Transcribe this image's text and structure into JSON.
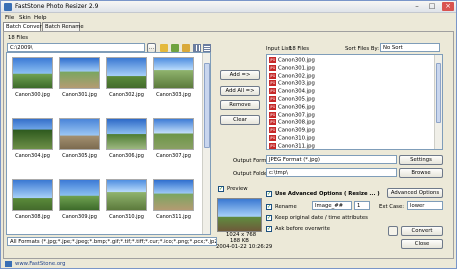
{
  "window": {
    "title": "FastStone Photo Resizer 2.9",
    "minimize_glyph": "–",
    "maximize_glyph": "□",
    "close_glyph": "×"
  },
  "menu": [
    "File",
    "Skin",
    "Help"
  ],
  "tabs": [
    "Batch Convert",
    "Batch Rename"
  ],
  "left": {
    "files_count": "18 Files",
    "folder_path": "C:\\2009\\",
    "thumbnails": [
      {
        "name": "Canon300.jpg",
        "style": "p0"
      },
      {
        "name": "Canon301.jpg",
        "style": "p1"
      },
      {
        "name": "Canon302.jpg",
        "style": "p2"
      },
      {
        "name": "Canon303.jpg",
        "style": "p3"
      },
      {
        "name": "Canon304.jpg",
        "style": "p4"
      },
      {
        "name": "Canon305.jpg",
        "style": "p5"
      },
      {
        "name": "Canon306.jpg",
        "style": "p6"
      },
      {
        "name": "Canon307.jpg",
        "style": "p7"
      },
      {
        "name": "Canon308.jpg",
        "style": "p2"
      },
      {
        "name": "Canon309.jpg",
        "style": "p0"
      },
      {
        "name": "Canon310.jpg",
        "style": "p3"
      },
      {
        "name": "Canon311.jpg",
        "style": "p1"
      }
    ],
    "format_filter": "All Formats (*.jpg;*.jpe;*.jpeg;*.bmp;*.gif;*.tif;*.tiff;*.cur;*.ico;*.png;*.pcx;*.jp2;*.j2k"
  },
  "middle": {
    "add": "Add =>",
    "add_all": "Add All =>",
    "remove": "Remove",
    "clear": "Clear"
  },
  "right": {
    "input_list_label": "Input List:",
    "input_count": "18 Files",
    "sort_label": "Sort Files By:",
    "sort_value": "No Sort",
    "input_files": [
      "Canon300.jpg",
      "Canon301.jpg",
      "Canon302.jpg",
      "Canon303.jpg",
      "Canon304.jpg",
      "Canon305.jpg",
      "Canon306.jpg",
      "Canon307.jpg",
      "Canon308.jpg",
      "Canon309.jpg",
      "Canon310.jpg",
      "Canon311.jpg"
    ],
    "output_format_label": "Output Format:",
    "output_format_value": "JPEG Format (*.jpg)",
    "settings": "Settings",
    "output_folder_label": "Output Folder:",
    "output_folder_value": "c:\\tmp\\",
    "browse": "Browse",
    "preview_label": "Preview",
    "preview_dims": "1024 x 768",
    "preview_size": "188 KB",
    "preview_date": "2004-01-22 10:26:29",
    "use_advanced": "Use Advanced Options ( Resize ... )",
    "advanced_options": "Advanced Options",
    "rename_label": "Rename",
    "rename_pattern": "Image_##",
    "rename_start": "1",
    "ext_case_label": "Ext Case:",
    "ext_case_value": "lower",
    "keep_date": "Keep original date / time attributes",
    "ask_overwrite": "Ask before overwrite",
    "convert": "Convert",
    "close": "Close"
  },
  "footer": {
    "link": "www.FastStone.org"
  },
  "colors": {
    "accent": "#3a6fb5",
    "file_icon": "#c62828",
    "check": "#1a7a1a"
  }
}
